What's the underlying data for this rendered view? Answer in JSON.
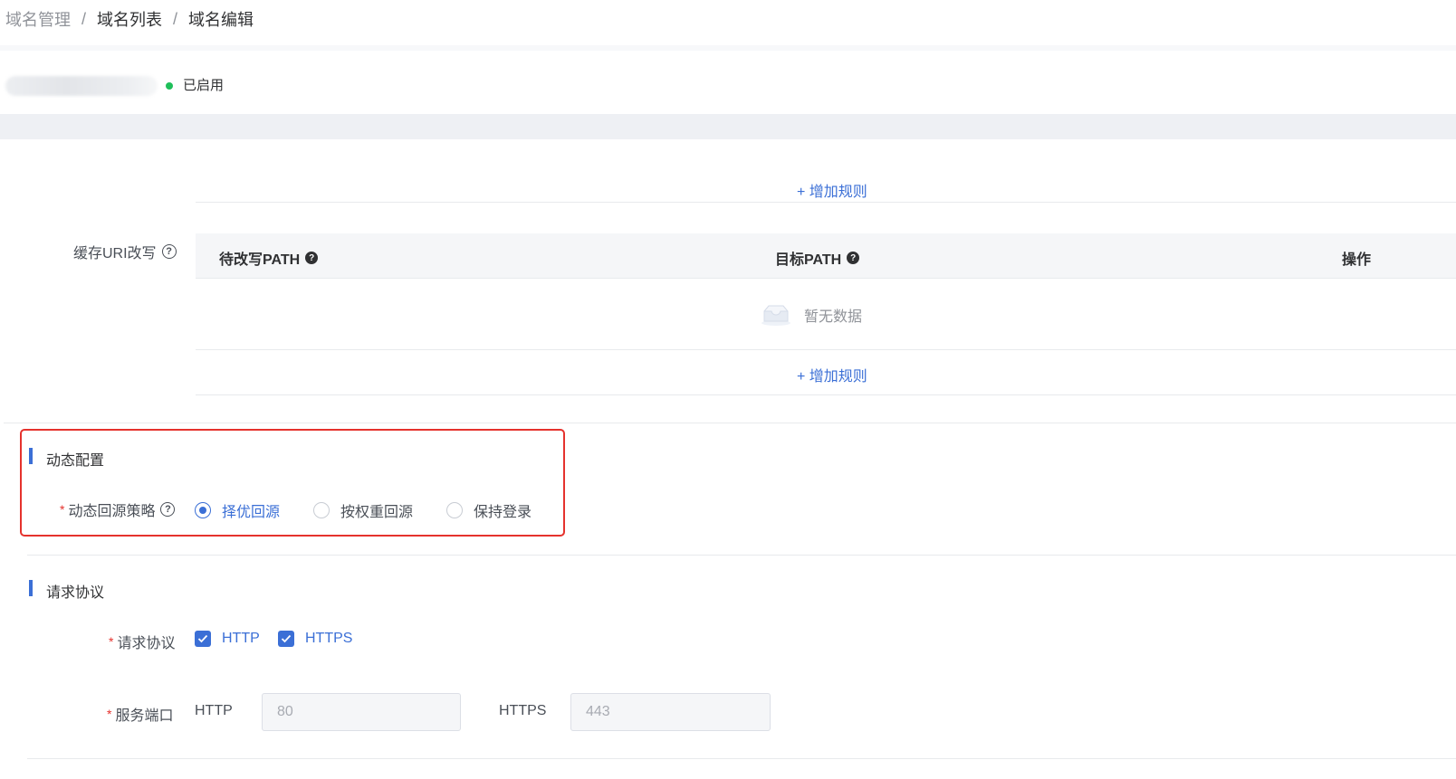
{
  "breadcrumb": {
    "items": [
      "域名管理",
      "域名列表",
      "域名编辑"
    ],
    "separator": "/"
  },
  "domain": {
    "status": "已启用",
    "status_color": "#1fbf5a"
  },
  "uri_rewrite": {
    "label": "缓存URI改写",
    "add_rule_label": "+ 增加规则",
    "columns": [
      "待改写PATH",
      "目标PATH",
      "操作"
    ],
    "empty_text": "暂无数据"
  },
  "dynamic_config": {
    "section_title": "动态配置",
    "strategy_label": "动态回源策略",
    "options": [
      "择优回源",
      "按权重回源",
      "保持登录"
    ],
    "selected": "择优回源"
  },
  "request_protocol": {
    "section_title": "请求协议",
    "protocol_label": "请求协议",
    "protocols": [
      "HTTP",
      "HTTPS"
    ],
    "port_label": "服务端口",
    "http_label": "HTTP",
    "http_port": "80",
    "https_label": "HTTPS",
    "https_port": "443"
  },
  "colors": {
    "accent": "#3b6fd6",
    "required": "#e5322d",
    "highlight_border": "#e5322d"
  }
}
